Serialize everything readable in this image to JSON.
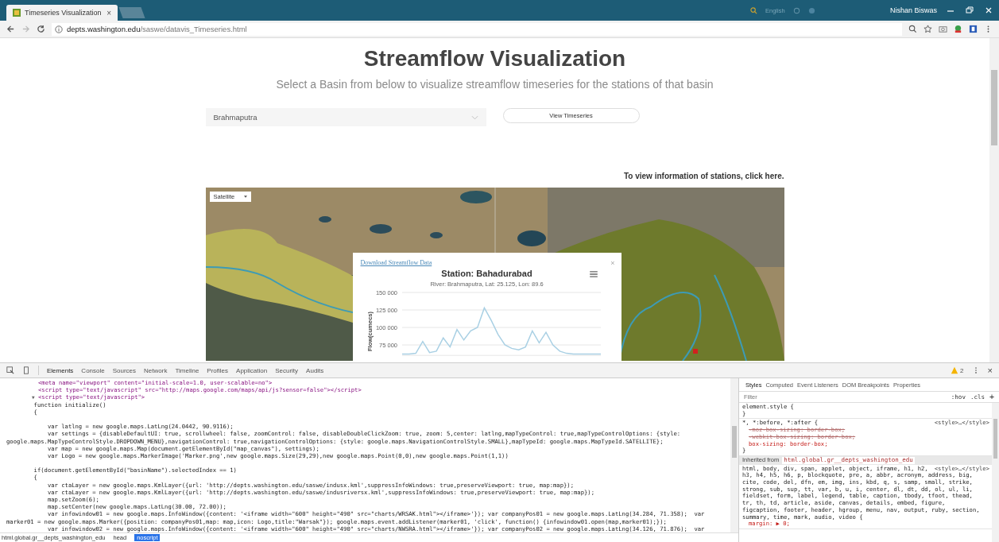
{
  "browser": {
    "tab": {
      "title": "Timeseries Visualization",
      "close": "×"
    },
    "toolbar_text": "English",
    "user": "Nishan Biswas",
    "url": {
      "host": "depts.washington.edu",
      "path": "/saswe/datavis_Timeseries.html"
    }
  },
  "page": {
    "title": "Streamflow Visualization",
    "subtitle": "Select a Basin from below to visualize streamflow timeseries for the stations of that basin",
    "basin_select": {
      "value": "Brahmaputra"
    },
    "view_button": "View Timeseries",
    "stations_link": "To view information of stations, click here.",
    "map": {
      "type_select": "Satellite",
      "popup": {
        "download_link": "Download Streamflow Data",
        "close": "×",
        "title": "Station: Bahadurabad",
        "subtitle": "River: Brahmaputra, Lat: 25.125, Lon: 89.6",
        "chart_data": {
          "type": "line",
          "ylabel": "Flow(cumecs)",
          "grid": true,
          "ylim": [
            60000,
            150000
          ],
          "yticks": [
            {
              "value": 75000,
              "label": "75 000"
            },
            {
              "value": 100000,
              "label": "100 000"
            },
            {
              "value": 125000,
              "label": "125 000"
            },
            {
              "value": 150000,
              "label": "150 000"
            }
          ],
          "series": [
            {
              "color": "#a9d0e4",
              "values": [
                62000,
                62000,
                63000,
                80000,
                64000,
                66000,
                85000,
                72000,
                97000,
                82000,
                95000,
                100000,
                128000,
                110000,
                90000,
                75000,
                70000,
                68000,
                72000,
                95000,
                78000,
                93000,
                75000,
                66000,
                63000,
                62000,
                62000,
                62000,
                62000,
                62000
              ]
            }
          ]
        }
      }
    }
  },
  "devtools": {
    "tabs": [
      {
        "label": "Elements",
        "selected": true
      },
      {
        "label": "Console",
        "selected": false
      },
      {
        "label": "Sources",
        "selected": false
      },
      {
        "label": "Network",
        "selected": false
      },
      {
        "label": "Timeline",
        "selected": false
      },
      {
        "label": "Profiles",
        "selected": false
      },
      {
        "label": "Application",
        "selected": false
      },
      {
        "label": "Security",
        "selected": false
      },
      {
        "label": "Audits",
        "selected": false
      }
    ],
    "warnings": "2",
    "close": "×",
    "code_lines": [
      {
        "kind": "markup",
        "text": "<meta name=\"viewport\" content=\"initial-scale=1.0, user-scalable=no\">"
      },
      {
        "kind": "markup",
        "text": "<script type=\"text/javascript\" src=\"http://maps.google.com/maps/api/js?sensor=false\"></script>"
      },
      {
        "kind": "markup",
        "toggle": "▼",
        "text": "<script type=\"text/javascript\">"
      },
      {
        "kind": "code",
        "text": "        function initialize()"
      },
      {
        "kind": "code",
        "text": "        {"
      },
      {
        "kind": "blank"
      },
      {
        "kind": "code",
        "text": "            var latlng = new google.maps.LatLng(24.0442, 90.9116);"
      },
      {
        "kind": "code",
        "text": "            var settings = {disableDefaultUI: true, scrollwheel: false, zoomControl: false, disableDoubleClickZoom: true, zoom: 5,center: latlng,mapTypeControl: true,mapTypeControlOptions: {style:"
      },
      {
        "kind": "code",
        "text": "google.maps.MapTypeControlStyle.DROPDOWN_MENU},navigationControl: true,navigationControlOptions: {style: google.maps.NavigationControlStyle.SMALL},mapTypeId: google.maps.MapTypeId.SATELLITE};"
      },
      {
        "kind": "code",
        "text": "            var map = new google.maps.Map(document.getElementById(\"map_canvas\"), settings);"
      },
      {
        "kind": "code",
        "text": "            var Logo = new google.maps.MarkerImage('Marker.png',new google.maps.Size(29,29),new google.maps.Point(0,0),new google.maps.Point(1,1))"
      },
      {
        "kind": "blank"
      },
      {
        "kind": "code",
        "text": "        if(document.getElementById(\"basinName\").selectedIndex == 1)"
      },
      {
        "kind": "code",
        "text": "        {"
      },
      {
        "kind": "code",
        "text": "            var ctaLayer = new google.maps.KmlLayer({url: 'http://depts.washington.edu/saswe/indusx.kml',suppressInfoWindows: true,preserveViewport: true, map:map});"
      },
      {
        "kind": "code",
        "text": "            var ctaLayer = new google.maps.KmlLayer({url: 'http://depts.washington.edu/saswe/indusriversx.kml',suppressInfoWindows: true,preserveViewport: true, map:map});"
      },
      {
        "kind": "code",
        "text": "            map.setZoom(6);"
      },
      {
        "kind": "code",
        "text": "            map.setCenter(new google.maps.LatLng(30.00, 72.00));"
      },
      {
        "kind": "code",
        "text": "            var infowindow01 = new google.maps.InfoWindow({content: '<iframe width=\"600\" height=\"490\" src=\"charts/WRSAK.html\"></iframe>'}); var companyPos01 = new google.maps.LatLng(34.284, 71.358);  var"
      },
      {
        "kind": "code",
        "text": "marker01 = new google.maps.Marker({position: companyPos01,map: map,icon: Logo,title:\"Warsak\"}); google.maps.event.addListener(marker01, 'click', function() {infowindow01.open(map,marker01);});"
      },
      {
        "kind": "code",
        "text": "            var infowindow02 = new google.maps.InfoWindow({content: '<iframe width=\"600\" height=\"490\" src=\"charts/NWSRA.html\"></iframe>'}); var companyPos02 = new google.maps.LatLng(34.126, 71.876);  var"
      }
    ],
    "breadcrumbs": [
      {
        "label": "html.global.gr__depts_washington_edu",
        "selected": false
      },
      {
        "label": "head",
        "selected": false
      },
      {
        "label": "noscript",
        "selected": true
      }
    ],
    "styles": {
      "tabs": [
        {
          "label": "Styles",
          "selected": true
        },
        {
          "label": "Computed",
          "selected": false
        },
        {
          "label": "Event Listeners",
          "selected": false
        },
        {
          "label": "DOM Breakpoints",
          "selected": false
        },
        {
          "label": "Properties",
          "selected": false
        }
      ],
      "filter": {
        "placeholder": "Filter"
      },
      "hov": ":hov",
      "cls": ".cls",
      "add": "+",
      "rules": [
        {
          "kind": "rule",
          "selector_lines": [
            "element.style {"
          ],
          "end": "}"
        },
        {
          "kind": "rule",
          "selector_lines": [
            "*, *:before, *:after {"
          ],
          "source": "<style>…</style>",
          "declarations": [
            {
              "text": "-moz-box-sizing: border-box;",
              "struck": true
            },
            {
              "text": "-webkit-box-sizing: border-box;",
              "struck": true
            },
            {
              "text": "box-sizing: border-box;",
              "struck": false
            }
          ],
          "end": "}"
        },
        {
          "kind": "inherited",
          "label": "Inherited from",
          "element": "html.global.gr__depts_washington_edu"
        },
        {
          "kind": "rule",
          "selector_lines": [
            "html, body, div, span, applet, object, iframe, h1, h2,",
            "h3, h4, h5, h6, p, blockquote, pre, a, abbr, acronym, address, big,",
            "cite, code, del, dfn, em, img, ins, kbd, q, s, samp, small, strike,",
            "strong, sub, sup, tt, var, b, u, i, center, dl, dt, dd, ol, ul, li,",
            "fieldset, form, label, legend, table, caption, tbody, tfoot, thead,",
            "tr, th, td, article, aside, canvas, details, embed, figure,",
            "figcaption, footer, header, hgroup, menu, nav, output, ruby, section,",
            "summary, time, mark, audio, video {"
          ],
          "source": "<style>…</style>",
          "declarations": [
            {
              "text": "margin: ▶ 0;",
              "struck": false
            }
          ]
        }
      ]
    }
  }
}
